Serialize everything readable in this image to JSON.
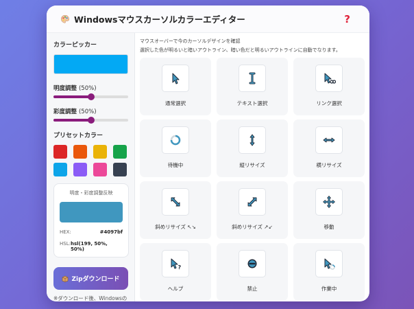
{
  "app": {
    "title": "Windowsマウスカーソルカラーエディター",
    "palette_icon": "palette-icon",
    "help_icon": "help-icon",
    "help_label": "?"
  },
  "sidebar": {
    "picker_title": "カラーピッカー",
    "picker_color": "#03a9f4",
    "brightness_label": "明度調整",
    "brightness_value": "(50%)",
    "brightness_level": 0.5,
    "saturation_label": "彩度調整",
    "saturation_value": "(50%)",
    "saturation_level": 0.5,
    "preset_title": "プリセットカラー",
    "presets": [
      "#dc2626",
      "#ea580c",
      "#eab308",
      "#16a34a",
      "#0ea5e9",
      "#8b5cf6",
      "#ec4899",
      "#374151"
    ],
    "preview": {
      "title": "明度・彩度調整反映",
      "color": "#4097bf",
      "hex_label": "HEX:",
      "hex_value": "#4097bf",
      "hsl_label": "HSL:",
      "hsl_value": "hsl(199, 50%, 50%)"
    },
    "zip_button": "Zipダウンロード",
    "zip_icon": "package-icon",
    "note": "※ダウンロード後、Windowsのマウス設定で適用してください"
  },
  "main": {
    "hint_line1": "マウスオーバーで今のカーソルデザインを確認",
    "hint_line2": "選択した色が明るいと暗いアウトライン、暗い色だと明るいアウトラインに自動でなります。",
    "cursors": [
      {
        "label": "通常選択",
        "icon": "arrow-cursor-icon"
      },
      {
        "label": "テキスト選択",
        "icon": "text-cursor-icon"
      },
      {
        "label": "リンク選択",
        "icon": "link-cursor-icon"
      },
      {
        "label": "待機中",
        "icon": "busy-cursor-icon"
      },
      {
        "label": "縦リサイズ",
        "icon": "vertical-resize-icon"
      },
      {
        "label": "横リサイズ",
        "icon": "horizontal-resize-icon"
      },
      {
        "label": "斜めリサイズ ↖↘",
        "icon": "diagonal-resize-1-icon"
      },
      {
        "label": "斜めリサイズ ↗↙",
        "icon": "diagonal-resize-2-icon"
      },
      {
        "label": "移動",
        "icon": "move-cursor-icon"
      },
      {
        "label": "ヘルプ",
        "icon": "help-cursor-icon"
      },
      {
        "label": "禁止",
        "icon": "unavailable-cursor-icon"
      },
      {
        "label": "作業中",
        "icon": "working-cursor-icon"
      }
    ]
  },
  "colors": {
    "cursor_fill": "#4097bf",
    "cursor_outline": "#1f2937",
    "accent": "#8a1c7c"
  }
}
